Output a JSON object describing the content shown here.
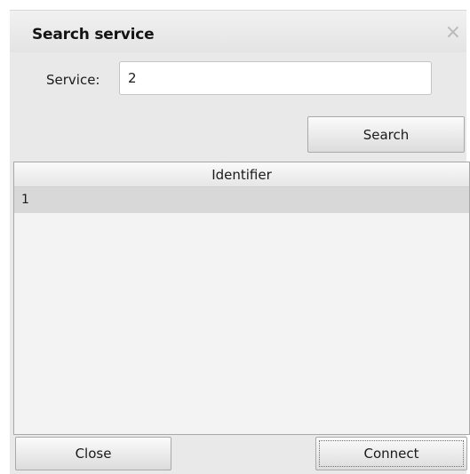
{
  "dialog": {
    "title": "Search service",
    "close_glyph": "×"
  },
  "form": {
    "service_label": "Service:",
    "service_value": "2",
    "search_button": "Search"
  },
  "table": {
    "columns": [
      "Identifier"
    ],
    "rows": [
      [
        "1"
      ]
    ]
  },
  "footer": {
    "close_button": "Close",
    "connect_button": "Connect"
  }
}
